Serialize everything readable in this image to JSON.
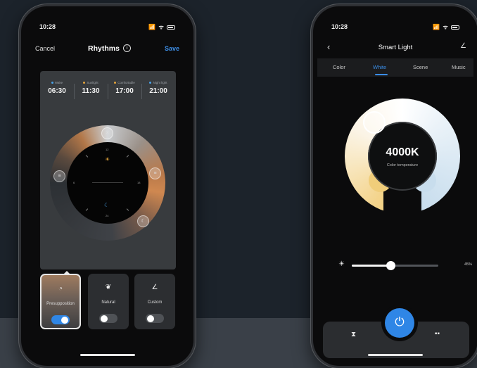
{
  "left_phone": {
    "status": {
      "time": "10:28",
      "icons": "📶 ᯤ"
    },
    "nav": {
      "cancel": "Cancel",
      "title": "Rhythms",
      "info": "i",
      "save": "Save"
    },
    "schedule": [
      {
        "label": "Wake",
        "time": "06:30",
        "color": "#4aa3e8"
      },
      {
        "label": "Sunlight",
        "time": "11:30",
        "color": "#e3a43a"
      },
      {
        "label": "Comfortable",
        "time": "17:00",
        "color": "#e3a43a"
      },
      {
        "label": "Night light",
        "time": "21:00",
        "color": "#4aa3e8"
      }
    ],
    "dial": {
      "numbers": {
        "top": "12",
        "right": "18",
        "bottom": "24",
        "left": "6"
      },
      "sun": "☀",
      "moon": "☾",
      "handles": {
        "top": "✕",
        "left": "≡",
        "right": "≡",
        "bottom": "☾"
      }
    },
    "modes": [
      {
        "label": "Presupposition",
        "icon": "◔",
        "enabled": true,
        "selected": true
      },
      {
        "label": "Natural",
        "icon": "❦",
        "enabled": false,
        "selected": false
      },
      {
        "label": "Custom",
        "icon": "∠",
        "enabled": false,
        "selected": false
      }
    ]
  },
  "right_phone": {
    "status": {
      "time": "10:28",
      "icons": "📶 ᯤ"
    },
    "nav": {
      "back": "‹",
      "title": "Smart Light",
      "edit": "∠"
    },
    "tabs": [
      {
        "label": "Color",
        "active": false
      },
      {
        "label": "White",
        "active": true
      },
      {
        "label": "Scene",
        "active": false
      },
      {
        "label": "Music",
        "active": false
      }
    ],
    "temperature": {
      "value": "4000K",
      "label": "Color temperature"
    },
    "brightness": {
      "icon": "☀",
      "value": 45,
      "label": "45%"
    },
    "bottom_bar": {
      "timer": "⧗",
      "power": "⏻",
      "grid": "▪▪"
    }
  }
}
